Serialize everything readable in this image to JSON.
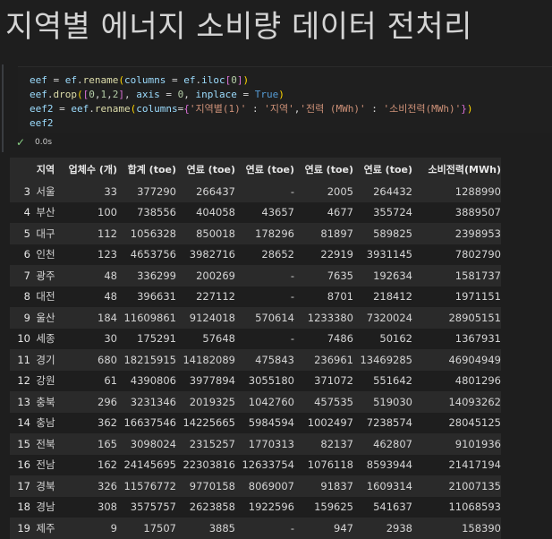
{
  "title": "지역별 에너지 소비량 데이터 전처리",
  "code": {
    "line1": {
      "a": "eef",
      "b": " = ",
      "c": "ef",
      "d": ".",
      "e": "rename",
      "f": "(",
      "g": "columns",
      "h": " = ",
      "i": "ef",
      "j": ".",
      "k": "iloc",
      "l": "[",
      "m": "0",
      "n": "]",
      "o": ")"
    },
    "line2": {
      "a": "eef",
      "b": ".",
      "c": "drop",
      "d": "(",
      "e": "[",
      "f": "0",
      "g": ",",
      "h": "1",
      "i": ",",
      "j": "2",
      "k": "]",
      "l": ", ",
      "m": "axis",
      "n": " = ",
      "o": "0",
      "p": ", ",
      "q": "inplace",
      "r": " = ",
      "s": "True",
      "t": ")"
    },
    "line3": {
      "a": "eef2",
      "b": " = ",
      "c": "eef",
      "d": ".",
      "e": "rename",
      "f": "(",
      "g": "columns",
      "h": "=",
      "i": "{",
      "j": "'지역별(1)'",
      "k": " : ",
      "l": "'지역'",
      "m": ",",
      "n": "'전력 (MWh)'",
      "o": " : ",
      "p": "'소비전력(MWh)'",
      "q": "}",
      "r": ")"
    },
    "line4": "eef2"
  },
  "status": {
    "check": "✓",
    "time": "0.0s"
  },
  "table": {
    "headers": [
      "",
      "지역",
      "업체수 (개)",
      "합계 (toe)",
      "연료 (toe)",
      "연료 (toe)",
      "연료 (toe)",
      "연료 (toe)",
      "소비전력(MWh)"
    ],
    "rows": [
      [
        "3",
        "서울",
        "33",
        "377290",
        "266437",
        "-",
        "2005",
        "264432",
        "1288990"
      ],
      [
        "4",
        "부산",
        "100",
        "738556",
        "404058",
        "43657",
        "4677",
        "355724",
        "3889507"
      ],
      [
        "5",
        "대구",
        "112",
        "1056328",
        "850018",
        "178296",
        "81897",
        "589825",
        "2398953"
      ],
      [
        "6",
        "인천",
        "123",
        "4653756",
        "3982716",
        "28652",
        "22919",
        "3931145",
        "7802790"
      ],
      [
        "7",
        "광주",
        "48",
        "336299",
        "200269",
        "-",
        "7635",
        "192634",
        "1581737"
      ],
      [
        "8",
        "대전",
        "48",
        "396631",
        "227112",
        "-",
        "8701",
        "218412",
        "1971151"
      ],
      [
        "9",
        "울산",
        "184",
        "11609861",
        "9124018",
        "570614",
        "1233380",
        "7320024",
        "28905151"
      ],
      [
        "10",
        "세종",
        "30",
        "175291",
        "57648",
        "-",
        "7486",
        "50162",
        "1367931"
      ],
      [
        "11",
        "경기",
        "680",
        "18215915",
        "14182089",
        "475843",
        "236961",
        "13469285",
        "46904949"
      ],
      [
        "12",
        "강원",
        "61",
        "4390806",
        "3977894",
        "3055180",
        "371072",
        "551642",
        "4801296"
      ],
      [
        "13",
        "충북",
        "296",
        "3231346",
        "2019325",
        "1042760",
        "457535",
        "519030",
        "14093262"
      ],
      [
        "14",
        "충남",
        "362",
        "16637546",
        "14225665",
        "5984594",
        "1002497",
        "7238574",
        "28045125"
      ],
      [
        "15",
        "전북",
        "165",
        "3098024",
        "2315257",
        "1770313",
        "82137",
        "462807",
        "9101936"
      ],
      [
        "16",
        "전남",
        "162",
        "24145695",
        "22303816",
        "12633754",
        "1076118",
        "8593944",
        "21417194"
      ],
      [
        "17",
        "경북",
        "326",
        "11576772",
        "9770158",
        "8069007",
        "91837",
        "1609314",
        "21007135"
      ],
      [
        "18",
        "경남",
        "308",
        "3575757",
        "2623858",
        "1922596",
        "159625",
        "541637",
        "11068593"
      ],
      [
        "19",
        "제주",
        "9",
        "17507",
        "3885",
        "-",
        "947",
        "2938",
        "158390"
      ]
    ]
  }
}
